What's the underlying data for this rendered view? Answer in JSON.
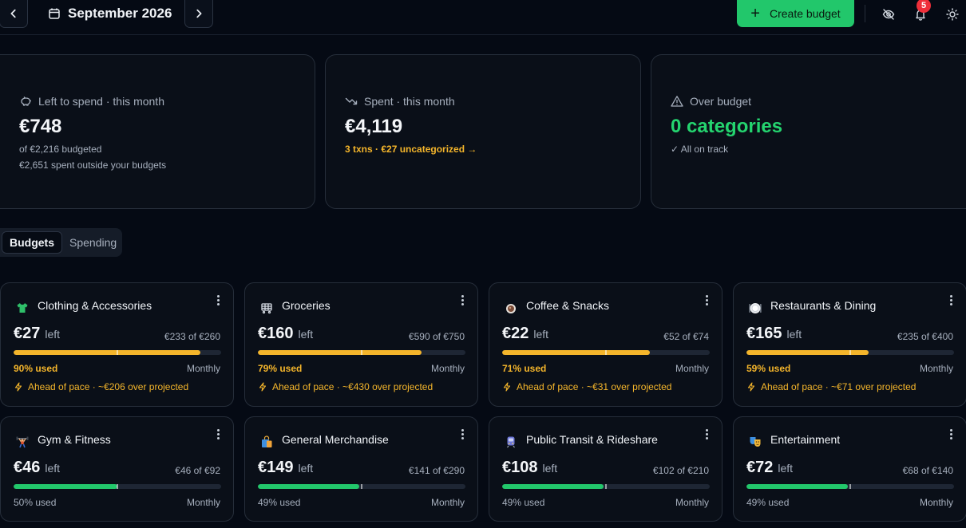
{
  "header": {
    "month": "September 2026",
    "create_label": "Create budget",
    "notification_count": "5"
  },
  "summary": {
    "left": {
      "label": "Left to spend · this month",
      "value": "€748",
      "sub1": "of €2,216 budgeted",
      "sub2": "€2,651 spent outside your budgets"
    },
    "spent": {
      "label": "Spent · this month",
      "value": "€4,119",
      "link": "3 txns · €27 uncategorized →"
    },
    "over": {
      "label": "Over budget",
      "value": "0 categories",
      "sub": "✓ All on track"
    }
  },
  "tabs": [
    "Budgets",
    "Spending"
  ],
  "budgets": [
    {
      "name": "Clothing & Accessories",
      "icon": "tshirt-icon",
      "left": "€27",
      "left_word": "left",
      "of": "€233 of €260",
      "used_pct": 90,
      "used": "90% used",
      "freq": "Monthly",
      "pace": "Ahead of pace · ~€206 over projected",
      "warn": true
    },
    {
      "name": "Groceries",
      "icon": "cart-icon",
      "left": "€160",
      "left_word": "left",
      "of": "€590 of €750",
      "used_pct": 79,
      "used": "79% used",
      "freq": "Monthly",
      "pace": "Ahead of pace · ~€430 over projected",
      "warn": true
    },
    {
      "name": "Coffee & Snacks",
      "icon": "coffee-icon",
      "left": "€22",
      "left_word": "left",
      "of": "€52 of €74",
      "used_pct": 71,
      "used": "71% used",
      "freq": "Monthly",
      "pace": "Ahead of pace · ~€31 over projected",
      "warn": true
    },
    {
      "name": "Restaurants & Dining",
      "icon": "plate-icon",
      "left": "€165",
      "left_word": "left",
      "of": "€235 of €400",
      "used_pct": 59,
      "used": "59% used",
      "freq": "Monthly",
      "pace": "Ahead of pace · ~€71 over projected",
      "warn": true
    },
    {
      "name": "Gym & Fitness",
      "icon": "weightlifter-icon",
      "left": "€46",
      "left_word": "left",
      "of": "€46 of €92",
      "used_pct": 50,
      "used": "50% used",
      "freq": "Monthly",
      "pace": "",
      "warn": false
    },
    {
      "name": "General Merchandise",
      "icon": "shopping-bag-icon",
      "left": "€149",
      "left_word": "left",
      "of": "€141 of €290",
      "used_pct": 49,
      "used": "49% used",
      "freq": "Monthly",
      "pace": "",
      "warn": false
    },
    {
      "name": "Public Transit & Rideshare",
      "icon": "train-icon",
      "left": "€108",
      "left_word": "left",
      "of": "€102 of €210",
      "used_pct": 49,
      "used": "49% used",
      "freq": "Monthly",
      "pace": "",
      "warn": false
    },
    {
      "name": "Entertainment",
      "icon": "theater-masks-icon",
      "left": "€72",
      "left_word": "left",
      "of": "€68 of €140",
      "used_pct": 49,
      "used": "49% used",
      "freq": "Monthly",
      "pace": "",
      "warn": false
    }
  ],
  "pace_marker_pct": 50,
  "colors": {
    "accent": "#22c76b",
    "warning": "#f4b52b",
    "ontrack": "#22c76b",
    "background": "#050a14",
    "badge": "#ef2f3a"
  }
}
